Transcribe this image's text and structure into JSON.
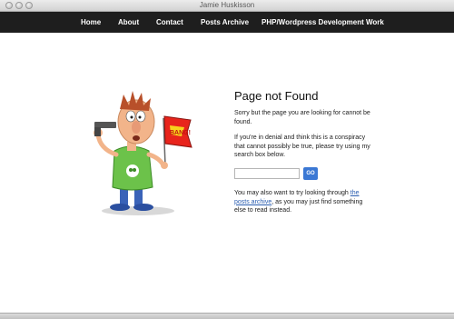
{
  "window": {
    "title": "Jamie Huskisson"
  },
  "nav": {
    "items": [
      {
        "label": "Home"
      },
      {
        "label": "About"
      },
      {
        "label": "Contact"
      },
      {
        "label": "Posts Archive"
      },
      {
        "label": "PHP/Wordpress Development Work"
      }
    ]
  },
  "main": {
    "heading": "Page not Found",
    "intro": "Sorry but the page you are looking for cannot be found.",
    "denial": "If you're in denial and think this is a conspiracy that cannot possibly be true, please try using my search box below.",
    "search": {
      "value": "",
      "placeholder": "",
      "button_label": "GO"
    },
    "archive_pre": "You may also want to try looking through ",
    "archive_link": "the posts archive",
    "archive_post": ", as you may just find something else to read instead."
  },
  "illustration": {
    "flag_text": "BANG!"
  },
  "colors": {
    "nav_bg": "#1e1e1e",
    "link": "#2a5db0",
    "button": "#3b78d4"
  }
}
